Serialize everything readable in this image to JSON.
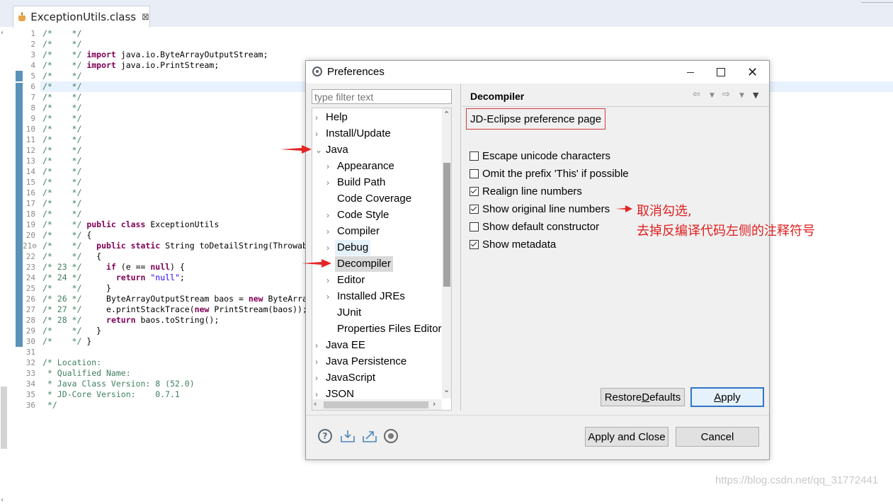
{
  "editor": {
    "tab_title": "ExceptionUtils.class",
    "tab_close": "⊠",
    "line_numbers": [
      "1",
      "2",
      "3",
      "4",
      "5",
      "6",
      "7",
      "8",
      "9",
      "10",
      "11",
      "12",
      "13",
      "14",
      "15",
      "16",
      "17",
      "18",
      "19",
      "20",
      "21⊖",
      "22",
      "23",
      "24",
      "25",
      "26",
      "27",
      "28",
      "29",
      "30",
      "31",
      "32",
      "33",
      "34",
      "35",
      "36"
    ],
    "code_lines": [
      [
        {
          "c": "cm",
          "t": "/*    */"
        }
      ],
      [
        {
          "c": "cm",
          "t": "/*    */"
        }
      ],
      [
        {
          "c": "cm",
          "t": "/*    */ "
        },
        {
          "c": "kw",
          "t": "import"
        },
        {
          "c": "fld",
          "t": " java.io.ByteArrayOutputStream;"
        }
      ],
      [
        {
          "c": "cm",
          "t": "/*    */ "
        },
        {
          "c": "kw",
          "t": "import"
        },
        {
          "c": "fld",
          "t": " java.io.PrintStream;"
        }
      ],
      [
        {
          "c": "cm",
          "t": "/*    */"
        }
      ],
      [
        {
          "c": "cm",
          "t": "/*    */"
        }
      ],
      [
        {
          "c": "cm",
          "t": "/*    */"
        }
      ],
      [
        {
          "c": "cm",
          "t": "/*    */"
        }
      ],
      [
        {
          "c": "cm",
          "t": "/*    */"
        }
      ],
      [
        {
          "c": "cm",
          "t": "/*    */"
        }
      ],
      [
        {
          "c": "cm",
          "t": "/*    */"
        }
      ],
      [
        {
          "c": "cm",
          "t": "/*    */"
        }
      ],
      [
        {
          "c": "cm",
          "t": "/*    */"
        }
      ],
      [
        {
          "c": "cm",
          "t": "/*    */"
        }
      ],
      [
        {
          "c": "cm",
          "t": "/*    */"
        }
      ],
      [
        {
          "c": "cm",
          "t": "/*    */"
        }
      ],
      [
        {
          "c": "cm",
          "t": "/*    */"
        }
      ],
      [
        {
          "c": "cm",
          "t": "/*    */"
        }
      ],
      [
        {
          "c": "cm",
          "t": "/*    */ "
        },
        {
          "c": "kw",
          "t": "public class"
        },
        {
          "c": "fld",
          "t": " ExceptionUtils"
        }
      ],
      [
        {
          "c": "cm",
          "t": "/*    */ "
        },
        {
          "c": "fld",
          "t": "{"
        }
      ],
      [
        {
          "c": "cm",
          "t": "/*    */   "
        },
        {
          "c": "kw",
          "t": "public static"
        },
        {
          "c": "fld",
          "t": " String toDetailString(Throwable e)"
        }
      ],
      [
        {
          "c": "cm",
          "t": "/*    */   "
        },
        {
          "c": "fld",
          "t": "{"
        }
      ],
      [
        {
          "c": "cm",
          "t": "/* 23 */     "
        },
        {
          "c": "kw",
          "t": "if"
        },
        {
          "c": "fld",
          "t": " (e == "
        },
        {
          "c": "kw",
          "t": "null"
        },
        {
          "c": "fld",
          "t": ") {"
        }
      ],
      [
        {
          "c": "cm",
          "t": "/* 24 */       "
        },
        {
          "c": "kw",
          "t": "return"
        },
        {
          "c": "fld",
          "t": " "
        },
        {
          "c": "str",
          "t": "\"null\""
        },
        {
          "c": "fld",
          "t": ";"
        }
      ],
      [
        {
          "c": "cm",
          "t": "/*    */     "
        },
        {
          "c": "fld",
          "t": "}"
        }
      ],
      [
        {
          "c": "cm",
          "t": "/* 26 */     "
        },
        {
          "c": "fld",
          "t": "ByteArrayOutputStream baos = "
        },
        {
          "c": "kw",
          "t": "new"
        },
        {
          "c": "fld",
          "t": " ByteArrayOutputStream();"
        }
      ],
      [
        {
          "c": "cm",
          "t": "/* 27 */     "
        },
        {
          "c": "fld",
          "t": "e.printStackTrace("
        },
        {
          "c": "kw",
          "t": "new"
        },
        {
          "c": "fld",
          "t": " PrintStream(baos));"
        }
      ],
      [
        {
          "c": "cm",
          "t": "/* 28 */     "
        },
        {
          "c": "kw",
          "t": "return"
        },
        {
          "c": "fld",
          "t": " baos.toString();"
        }
      ],
      [
        {
          "c": "cm",
          "t": "/*    */   "
        },
        {
          "c": "fld",
          "t": "}"
        }
      ],
      [
        {
          "c": "cm",
          "t": "/*    */ "
        },
        {
          "c": "fld",
          "t": "}"
        }
      ],
      [],
      [
        {
          "c": "cm",
          "t": "/* Location:"
        }
      ],
      [
        {
          "c": "cm",
          "t": " * Qualified Name:"
        }
      ],
      [
        {
          "c": "cm",
          "t": " * Java Class Version: 8 (52.0)"
        }
      ],
      [
        {
          "c": "cm",
          "t": " * JD-Core Version:    0.7.1"
        }
      ],
      [
        {
          "c": "cm",
          "t": " */"
        }
      ]
    ]
  },
  "dialog": {
    "title": "Preferences",
    "filter_placeholder": "type filter text",
    "tree": [
      {
        "label": "Help",
        "depth": 0,
        "chevron": "›"
      },
      {
        "label": "Install/Update",
        "depth": 0,
        "chevron": "›"
      },
      {
        "label": "Java",
        "depth": 0,
        "chevron": "⌄"
      },
      {
        "label": "Appearance",
        "depth": 1,
        "chevron": "›"
      },
      {
        "label": "Build Path",
        "depth": 1,
        "chevron": "›"
      },
      {
        "label": "Code Coverage",
        "depth": 1,
        "chevron": ""
      },
      {
        "label": "Code Style",
        "depth": 1,
        "chevron": "›"
      },
      {
        "label": "Compiler",
        "depth": 1,
        "chevron": "›"
      },
      {
        "label": "Debug",
        "depth": 1,
        "chevron": "›",
        "state": "hover"
      },
      {
        "label": "Decompiler",
        "depth": 1,
        "chevron": "",
        "state": "selected"
      },
      {
        "label": "Editor",
        "depth": 1,
        "chevron": "›"
      },
      {
        "label": "Installed JREs",
        "depth": 1,
        "chevron": "›"
      },
      {
        "label": "JUnit",
        "depth": 1,
        "chevron": ""
      },
      {
        "label": "Properties Files Editor",
        "depth": 1,
        "chevron": ""
      },
      {
        "label": "Java EE",
        "depth": 0,
        "chevron": "›"
      },
      {
        "label": "Java Persistence",
        "depth": 0,
        "chevron": "›"
      },
      {
        "label": "JavaScript",
        "depth": 0,
        "chevron": "›"
      },
      {
        "label": "JSON",
        "depth": 0,
        "chevron": "›"
      }
    ],
    "page_title": "Decompiler",
    "page_description": "JD-Eclipse preference page",
    "options": [
      {
        "label": "Escape unicode characters",
        "checked": false
      },
      {
        "label": "Omit the prefix 'This' if possible",
        "checked": false
      },
      {
        "label": "Realign line numbers",
        "checked": true
      },
      {
        "label": "Show original line numbers",
        "checked": true
      },
      {
        "label": "Show default constructor",
        "checked": false
      },
      {
        "label": "Show metadata",
        "checked": true
      }
    ],
    "restore_defaults_pre": "Restore ",
    "restore_defaults_u": "D",
    "restore_defaults_post": "efaults",
    "apply_u": "A",
    "apply_post": "pply",
    "apply_and_close": "Apply and Close",
    "cancel": "Cancel",
    "help_glyph": "?"
  },
  "annotation": {
    "line1": "取消勾选,",
    "line2": "去掉反编译代码左侧的注释符号",
    "color": "#e02020"
  },
  "watermark": "https://blog.csdn.net/qq_31772441"
}
